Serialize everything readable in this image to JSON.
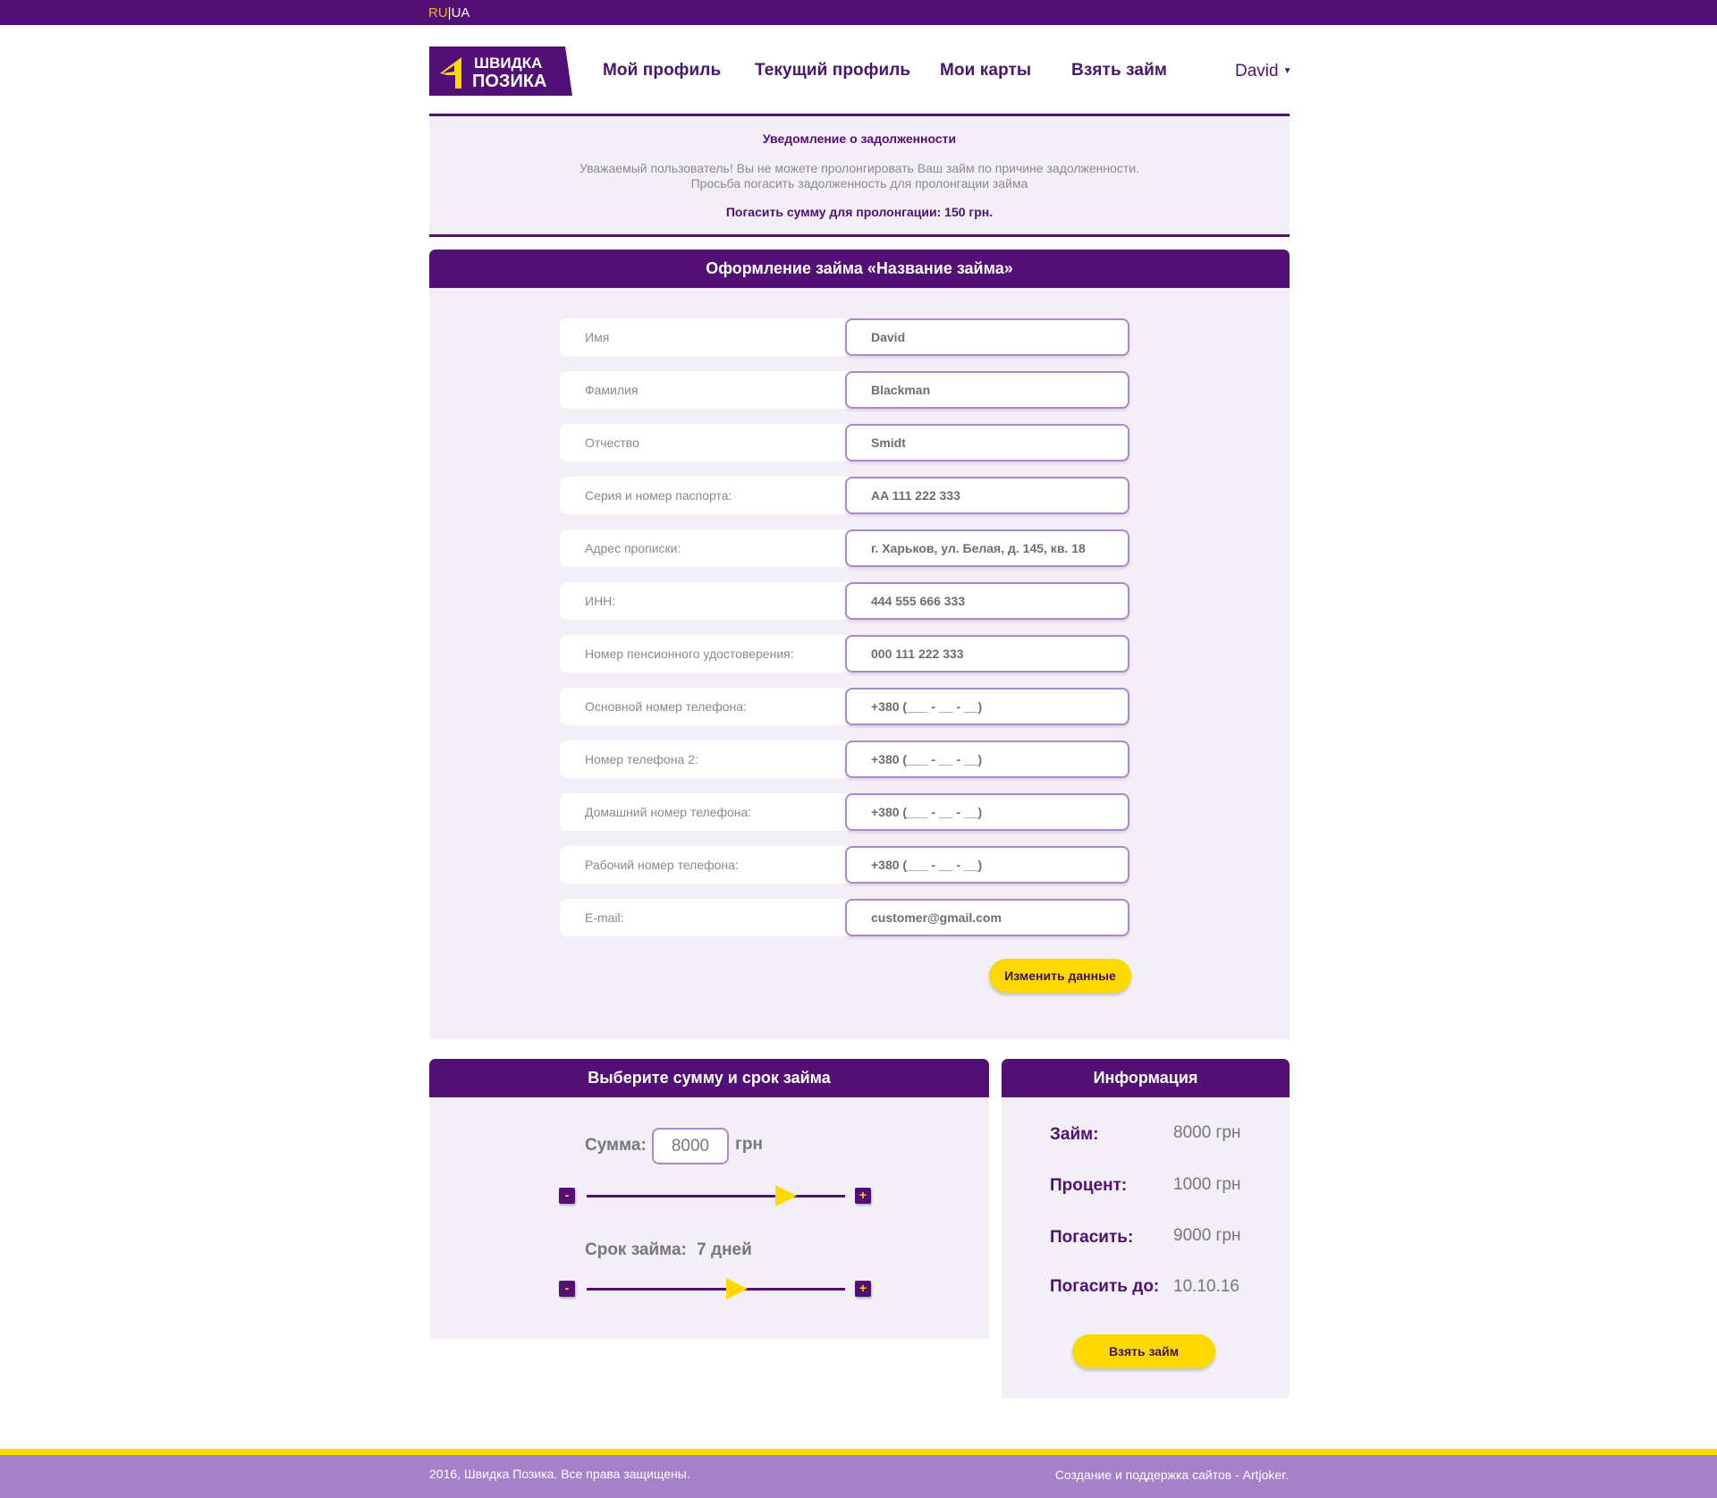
{
  "lang": {
    "active": "RU",
    "separator": "|",
    "other": "UA"
  },
  "logo": {
    "line1": "ШВИДКА",
    "line2": "ПОЗИКА"
  },
  "nav": {
    "items": [
      "Мой профиль",
      "Текущий профиль",
      "Мои карты",
      "Взять займ"
    ],
    "user": "David"
  },
  "notice": {
    "title": "Уведомление о задолженности",
    "line1": "Уважаемый пользователь! Вы не можете пролонгировать Ваш займ по причине задолженности.",
    "line2": "Просьба погасить задолженность для пролонгации займа",
    "sum": "Погасить сумму для пролонгации: 150 грн."
  },
  "form": {
    "title": "Оформление займа «Название займа»",
    "fields": [
      {
        "label": "Имя",
        "value": "David"
      },
      {
        "label": "Фамилия",
        "value": "Blackman"
      },
      {
        "label": "Отчество",
        "value": "Smidt"
      },
      {
        "label": "Серия и номер паспорта:",
        "value": "AA 111 222 333"
      },
      {
        "label": "Адрес прописки:",
        "value": "г. Харьков, ул. Белая, д. 145, кв. 18"
      },
      {
        "label": "ИНН:",
        "value": "444 555 666 333"
      },
      {
        "label": "Номер пенсионного удостоверения:",
        "value": "000 111 222 333"
      },
      {
        "label": "Основной номер телефона:",
        "value": "+380 (___ - __ - __)"
      },
      {
        "label": "Номер телефона 2:",
        "value": "+380 (___ - __ - __)"
      },
      {
        "label": "Домашний номер телефона:",
        "value": "+380 (___ - __ - __)"
      },
      {
        "label": "Рабочий номер телефона:",
        "value": "+380 (___ - __ - __)"
      },
      {
        "label": "E-mail:",
        "value": "customer@gmail.com"
      }
    ],
    "edit_button": "Изменить данные"
  },
  "calculator": {
    "title": "Выберите сумму и срок займа",
    "sum_label": "Сумма:",
    "sum_value": "8000",
    "sum_unit": "грн",
    "term_label": "Срок займа:",
    "term_value": "7 дней",
    "minus": "-",
    "plus": "+",
    "sum_slider_fraction": 0.77,
    "term_slider_fraction": 0.58
  },
  "info": {
    "title": "Информация",
    "rows": [
      {
        "label": "Займ:",
        "value": "8000 грн"
      },
      {
        "label": "Процент:",
        "value": "1000 грн"
      },
      {
        "label": "Погасить:",
        "value": "9000 грн"
      },
      {
        "label": "Погасить до:",
        "value": "10.10.16"
      }
    ],
    "button": "Взять займ"
  },
  "footer": {
    "left": "2016, Швидка Позика. Все права защищены.",
    "right": "Создание и поддержка сайтов - Artjoker."
  },
  "colors": {
    "primary": "#520f75",
    "accent": "#ffd800",
    "panel_bg": "#f3eff6",
    "footer_bg": "#a581c7"
  }
}
